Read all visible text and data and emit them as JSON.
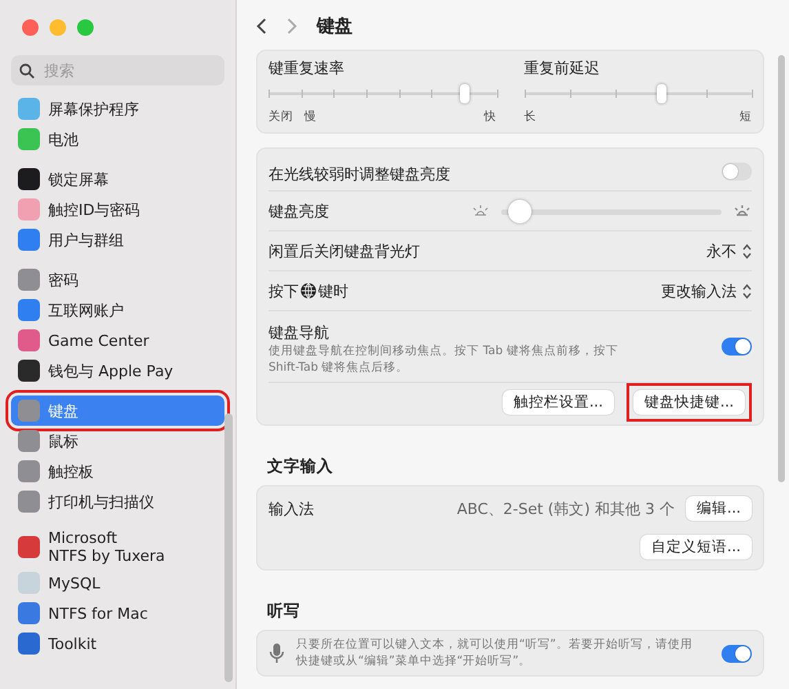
{
  "window": {
    "title": "键盘"
  },
  "search": {
    "placeholder": "搜索"
  },
  "sidebar": {
    "groups": [
      {
        "items": [
          {
            "label": "屏幕保护程序",
            "color": "#5ab4e8",
            "selected": false,
            "annotated": false
          },
          {
            "label": "电池",
            "color": "#3cc453",
            "selected": false,
            "annotated": false
          }
        ]
      },
      {
        "items": [
          {
            "label": "锁定屏幕",
            "color": "#1c1c1e",
            "selected": false,
            "annotated": false
          },
          {
            "label": "触控ID与密码",
            "color": "#f0a0b0",
            "selected": false,
            "annotated": false
          },
          {
            "label": "用户与群组",
            "color": "#2f7ff0",
            "selected": false,
            "annotated": false
          }
        ]
      },
      {
        "items": [
          {
            "label": "密码",
            "color": "#8e8e93",
            "selected": false,
            "annotated": false
          },
          {
            "label": "互联网账户",
            "color": "#2f7ff0",
            "selected": false,
            "annotated": false
          },
          {
            "label": "Game Center",
            "color": "#e05a8a",
            "selected": false,
            "annotated": false
          },
          {
            "label": "钱包与 Apple Pay",
            "color": "#2a2a2a",
            "selected": false,
            "annotated": false
          }
        ]
      },
      {
        "items": [
          {
            "label": "键盘",
            "color": "#8e8e93",
            "selected": true,
            "annotated": true
          },
          {
            "label": "鼠标",
            "color": "#8e8e93",
            "selected": false,
            "annotated": false
          },
          {
            "label": "触控板",
            "color": "#8e8e93",
            "selected": false,
            "annotated": false
          },
          {
            "label": "打印机与扫描仪",
            "color": "#8e8e93",
            "selected": false,
            "annotated": false
          }
        ]
      },
      {
        "items": [
          {
            "label": "Microsoft\nNTFS by Tuxera",
            "color": "#d63a3a",
            "selected": false,
            "annotated": false
          },
          {
            "label": "MySQL",
            "color": "#c8d4dc",
            "selected": false,
            "annotated": false
          },
          {
            "label": "NTFS for Mac",
            "color": "#3a7ae0",
            "selected": false,
            "annotated": false
          },
          {
            "label": "Toolkit",
            "color": "#2a6ad0",
            "selected": false,
            "annotated": false
          }
        ]
      }
    ]
  },
  "repeat": [
    {
      "title": "键重复速率",
      "level": 0.86,
      "left": [
        "关闭",
        "慢"
      ],
      "right": "快"
    },
    {
      "title": "重复前延迟",
      "level": 0.6,
      "left": [
        "长"
      ],
      "right": "短"
    }
  ],
  "settings": [
    {
      "kind": "toggle",
      "label": "在光线较弱时调整键盘亮度",
      "on": false
    },
    {
      "kind": "slider",
      "label": "键盘亮度",
      "level": 0.08
    },
    {
      "kind": "popup",
      "label": "闲置后关闭键盘背光灯",
      "value": "永不"
    },
    {
      "kind": "popup",
      "label": "按下",
      "label_after": "键时",
      "value": "更改输入法"
    },
    {
      "kind": "toggle",
      "label": "键盘导航",
      "on": true,
      "description": "使用键盘导航在控制间移动焦点。按下 Tab 键将焦点前移，按下 Shift-Tab 键将焦点后移。"
    },
    {
      "kind": "buttons",
      "buttons": [
        {
          "label": "触控栏设置...",
          "annotated": false
        },
        {
          "label": "键盘快捷键...",
          "annotated": true
        }
      ]
    }
  ],
  "text_input": {
    "title": "文字输入",
    "label": "输入法",
    "value": "ABC、2-Set (韩文) 和其他 3 个",
    "edit_button": "编辑...",
    "phrases_button": "自定义短语..."
  },
  "dictation": {
    "title": "听写",
    "description": "只要所在位置可以键入文本，就可以使用“听写”。若要开始听写，请使用快捷键或从“编辑”菜单中选择“开始听写”。",
    "on": true
  }
}
